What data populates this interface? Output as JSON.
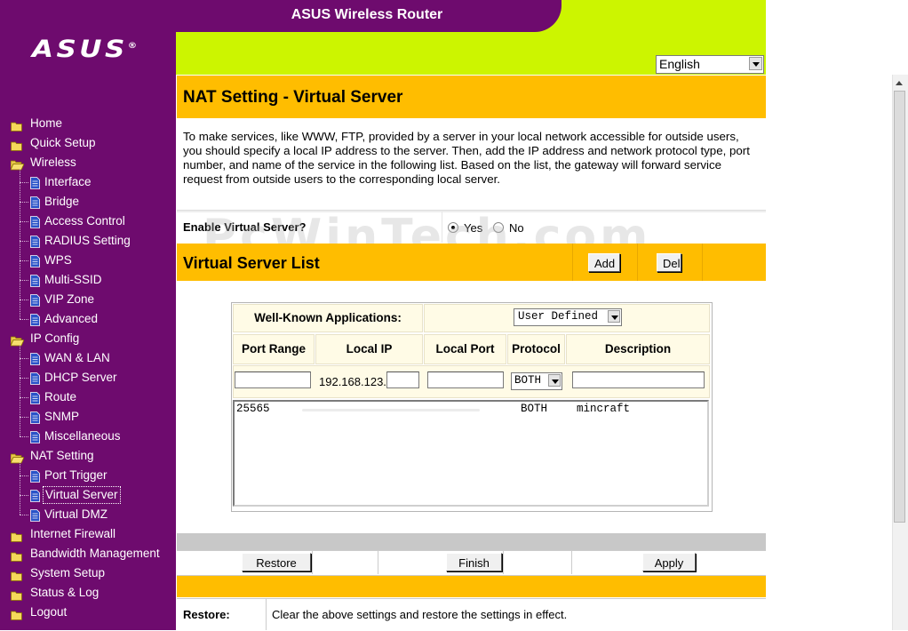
{
  "header": {
    "title": "ASUS Wireless Router",
    "logo": "ASUS",
    "logo_mark": "®"
  },
  "language": {
    "selected": "English"
  },
  "colors": {
    "sidebar": "#6e0b6e",
    "lime": "#ccf500",
    "accent": "#ffbd00"
  },
  "sidebar": {
    "items": [
      {
        "label": "Home",
        "level": 0,
        "icon": "folder-icon"
      },
      {
        "label": "Quick Setup",
        "level": 0,
        "icon": "folder-icon"
      },
      {
        "label": "Wireless",
        "level": 0,
        "icon": "folder-open-icon"
      },
      {
        "label": "Interface",
        "level": 1,
        "icon": "page-icon"
      },
      {
        "label": "Bridge",
        "level": 1,
        "icon": "page-icon"
      },
      {
        "label": "Access Control",
        "level": 1,
        "icon": "page-icon"
      },
      {
        "label": "RADIUS Setting",
        "level": 1,
        "icon": "page-icon"
      },
      {
        "label": "WPS",
        "level": 1,
        "icon": "page-icon"
      },
      {
        "label": "Multi-SSID",
        "level": 1,
        "icon": "page-icon"
      },
      {
        "label": "VIP Zone",
        "level": 1,
        "icon": "page-icon"
      },
      {
        "label": "Advanced",
        "level": 1,
        "icon": "page-icon"
      },
      {
        "label": "IP Config",
        "level": 0,
        "icon": "folder-open-icon"
      },
      {
        "label": "WAN & LAN",
        "level": 1,
        "icon": "page-icon"
      },
      {
        "label": "DHCP Server",
        "level": 1,
        "icon": "page-icon"
      },
      {
        "label": "Route",
        "level": 1,
        "icon": "page-icon"
      },
      {
        "label": "SNMP",
        "level": 1,
        "icon": "page-icon"
      },
      {
        "label": "Miscellaneous",
        "level": 1,
        "icon": "page-icon"
      },
      {
        "label": "NAT Setting",
        "level": 0,
        "icon": "folder-open-icon"
      },
      {
        "label": "Port Trigger",
        "level": 1,
        "icon": "page-icon"
      },
      {
        "label": "Virtual Server",
        "level": 1,
        "icon": "page-icon",
        "selected": true
      },
      {
        "label": "Virtual DMZ",
        "level": 1,
        "icon": "page-icon"
      },
      {
        "label": "Internet Firewall",
        "level": 0,
        "icon": "folder-icon"
      },
      {
        "label": "Bandwidth Management",
        "level": 0,
        "icon": "folder-icon"
      },
      {
        "label": "System Setup",
        "level": 0,
        "icon": "folder-icon"
      },
      {
        "label": "Status & Log",
        "level": 0,
        "icon": "folder-icon"
      },
      {
        "label": "Logout",
        "level": 0,
        "icon": "folder-icon"
      }
    ]
  },
  "page": {
    "title": "NAT Setting - Virtual Server",
    "description": "To make services, like WWW, FTP, provided by a server in your local network accessible for outside users, you should specify a local IP address to the server. Then, add the IP address and network protocol type, port number, and name of the service in the following list. Based on the list, the gateway will forward service request from outside users to the corresponding local server.",
    "enable_label": "Enable Virtual Server?",
    "enable_yes": "Yes",
    "enable_no": "No",
    "enable_value": "Yes"
  },
  "server_list": {
    "title": "Virtual Server List",
    "add_label": "Add",
    "del_label": "Del",
    "well_known_label": "Well-Known Applications:",
    "well_known_value": "User Defined",
    "columns": [
      "Port Range",
      "Local IP",
      "Local Port",
      "Protocol",
      "Description"
    ],
    "ip_prefix": "192.168.123.",
    "protocol_value": "BOTH",
    "entries": [
      {
        "port": "25565",
        "protocol": "BOTH",
        "description": "mincraft"
      }
    ]
  },
  "footer": {
    "restore_label": "Restore",
    "finish_label": "Finish",
    "apply_label": "Apply",
    "restore_title": "Restore:",
    "restore_desc": "Clear the above settings and restore the settings in effect."
  },
  "watermark": "PcWinTech.com"
}
